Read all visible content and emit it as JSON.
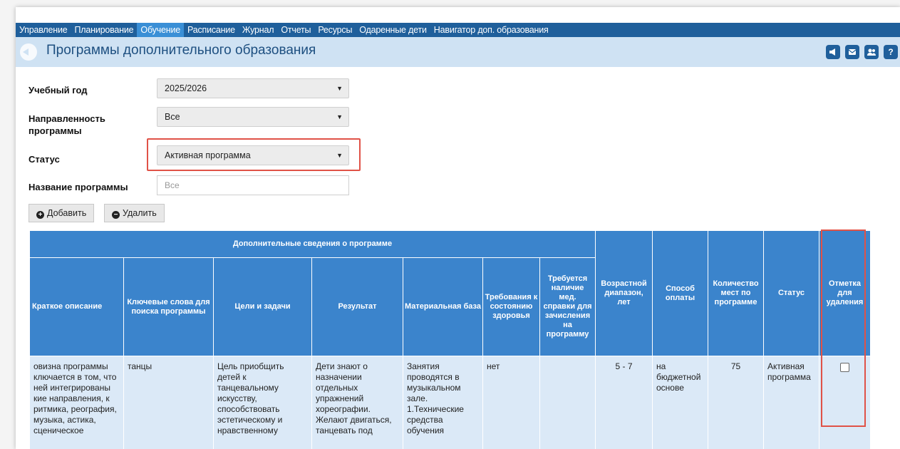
{
  "nav": {
    "items": [
      "Управление",
      "Планирование",
      "Обучение",
      "Расписание",
      "Журнал",
      "Отчеты",
      "Ресурсы",
      "Одаренные дети",
      "Навигатор доп. образования"
    ],
    "active": "Обучение"
  },
  "page": {
    "title": "Программы дополнительного образования",
    "icons": [
      "megaphone-icon",
      "mail-icon",
      "users-icon",
      "help-icon"
    ],
    "help_glyph": "?"
  },
  "filters": {
    "year_label": "Учебный год",
    "year_value": "2025/2026",
    "direction_label": "Направленность программы",
    "direction_value": "Все",
    "status_label": "Статус",
    "status_value": "Активная программа",
    "name_label": "Название программы",
    "name_placeholder": "Все"
  },
  "actions": {
    "add_label": "Добавить",
    "delete_label": "Удалить"
  },
  "table": {
    "group_header": "Дополнительные сведения о программе",
    "columns": [
      "Краткое описание",
      "Ключевые слова для поиска программы",
      "Цели и задачи",
      "Результат",
      "Материальная база",
      "Требования к состоянию здоровья",
      "Требуется наличие мед. справки для зачисления на программу",
      "Возрастной диапазон, лет",
      "Способ оплаты",
      "Количество мест по программе",
      "Статус",
      "Отметка для удаления"
    ],
    "row": {
      "description": "овизна программы ключается в том, что ней интегрированы кие направления, к ритмика, реография, музыка, астика, сценическое",
      "keywords": "танцы",
      "goals": "Цель приобщить детей к танцевальному искусству, способствовать эстетическому и нравственному",
      "result": "Дети знают о назначении отдельных упражнений хореографии. Желают двигаться, танцевать под",
      "base": "Занятия проводятся в музыкальном зале. 1.Технические средства обучения",
      "health": "нет",
      "med": "",
      "age": "5 - 7",
      "payment": "на бюджетной основе",
      "seats": "75",
      "status": "Активная программа"
    }
  },
  "colors": {
    "nav_bg": "#1f5f9b",
    "nav_active": "#3a8fd6",
    "title_bar": "#cfe2f3",
    "header_bg": "#3b84cc",
    "row_bg": "#dbe9f7",
    "highlight": "#e05247"
  }
}
